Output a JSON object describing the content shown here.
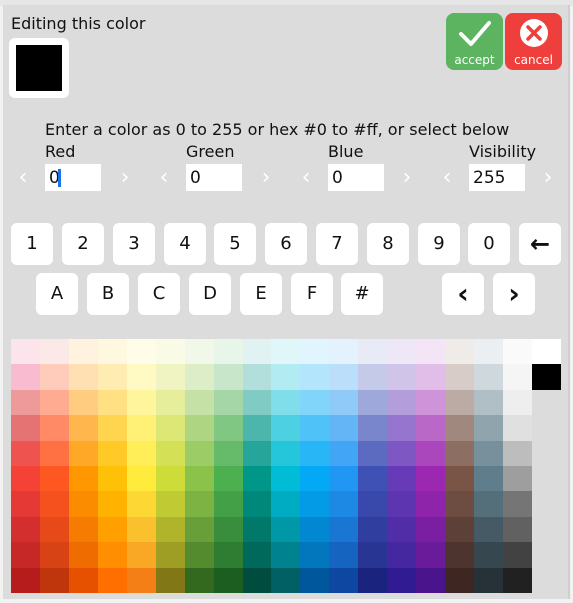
{
  "ruler": [
    "21",
    "28",
    "35",
    "42",
    "49",
    "56",
    "63",
    "70",
    "77",
    "84",
    "91"
  ],
  "title": "Editing this color",
  "current_color": "#000000",
  "accept": {
    "label": "accept",
    "color": "#5cb460",
    "icon": "check-icon"
  },
  "cancel": {
    "label": "cancel",
    "color": "#ef3f3d",
    "icon": "close-icon"
  },
  "instructions": "Enter a color as 0 to 255 or hex #0 to #ff, or select below",
  "channels": [
    {
      "label": "Red",
      "value": "0"
    },
    {
      "label": "Green",
      "value": "0"
    },
    {
      "label": "Blue",
      "value": "0"
    },
    {
      "label": "Visibility",
      "value": "255"
    }
  ],
  "chevrons": {
    "left": "‹",
    "right": "›"
  },
  "digit_keys": [
    "1",
    "2",
    "3",
    "4",
    "5",
    "6",
    "7",
    "8",
    "9",
    "0"
  ],
  "backspace_key": "←",
  "hex_keys": [
    "A",
    "B",
    "C",
    "D",
    "E",
    "F",
    "#"
  ],
  "nav_keys": [
    "‹",
    "›"
  ],
  "palette_rows": [
    [
      "#fce4ec",
      "#fbe9e7",
      "#fff3e0",
      "#fff8e1",
      "#fffde7",
      "#f9fbe7",
      "#f1f8e9",
      "#e8f5e9",
      "#e0f2f1",
      "#e0f7fa",
      "#e1f5fe",
      "#e3f2fd",
      "#e8eaf6",
      "#ede7f6",
      "#f3e5f5",
      "#efebe9",
      "#eceff1",
      "#fafafa"
    ],
    [
      "#f8bbd0",
      "#ffccbc",
      "#ffe0b2",
      "#ffecb3",
      "#fff9c4",
      "#f0f4c3",
      "#dcedc8",
      "#c8e6c9",
      "#b2dfdb",
      "#b2ebf2",
      "#b3e5fc",
      "#bbdefb",
      "#c5cae9",
      "#d1c4e9",
      "#e1bee7",
      "#d7ccc8",
      "#cfd8dc",
      "#f5f5f5"
    ],
    [
      "#ef9a9a",
      "#ffab91",
      "#ffcc80",
      "#ffe082",
      "#fff59d",
      "#e6ee9c",
      "#c5e1a5",
      "#a5d6a7",
      "#80cbc4",
      "#80deea",
      "#81d4fa",
      "#90caf9",
      "#9fa8da",
      "#b39ddb",
      "#ce93d8",
      "#bcaaa4",
      "#b0bec5",
      "#eeeeee"
    ],
    [
      "#e57373",
      "#ff8a65",
      "#ffb74d",
      "#ffd54f",
      "#fff176",
      "#dce775",
      "#aed581",
      "#81c784",
      "#4db6ac",
      "#4dd0e1",
      "#4fc3f7",
      "#64b5f6",
      "#7986cb",
      "#9575cd",
      "#ba68c8",
      "#a1887f",
      "#90a4ae",
      "#e0e0e0"
    ],
    [
      "#ef5350",
      "#ff7043",
      "#ffa726",
      "#ffca28",
      "#ffee58",
      "#d4e157",
      "#9ccc65",
      "#66bb6a",
      "#26a69a",
      "#26c6da",
      "#29b6f6",
      "#42a5f5",
      "#5c6bc0",
      "#7e57c2",
      "#ab47bc",
      "#8d6e63",
      "#78909c",
      "#bdbdbd"
    ],
    [
      "#f44336",
      "#ff5722",
      "#ff9800",
      "#ffc107",
      "#ffeb3b",
      "#cddc39",
      "#8bc34a",
      "#4caf50",
      "#009688",
      "#00bcd4",
      "#03a9f4",
      "#2196f3",
      "#3f51b5",
      "#673ab7",
      "#9c27b0",
      "#795548",
      "#607d8b",
      "#9e9e9e"
    ],
    [
      "#e53935",
      "#f4511e",
      "#fb8c00",
      "#ffb300",
      "#fdd835",
      "#c0ca33",
      "#7cb342",
      "#43a047",
      "#00897b",
      "#00acc1",
      "#039be5",
      "#1e88e5",
      "#3949ab",
      "#5e35b1",
      "#8e24aa",
      "#6d4c41",
      "#546e7a",
      "#757575"
    ],
    [
      "#d32f2f",
      "#e64a19",
      "#f57c00",
      "#ffa000",
      "#fbc02d",
      "#afb42b",
      "#689f38",
      "#388e3c",
      "#00796b",
      "#0097a7",
      "#0288d1",
      "#1976d2",
      "#303f9f",
      "#512da8",
      "#7b1fa2",
      "#5d4037",
      "#455a64",
      "#616161"
    ],
    [
      "#c62828",
      "#d84315",
      "#ef6c00",
      "#ff8f00",
      "#f9a825",
      "#9e9d24",
      "#558b2f",
      "#2e7d32",
      "#00695c",
      "#00838f",
      "#0277bd",
      "#1565c0",
      "#283593",
      "#4527a0",
      "#6a1b9a",
      "#4e342e",
      "#37474f",
      "#424242"
    ],
    [
      "#b71c1c",
      "#bf360c",
      "#e65100",
      "#ff6f00",
      "#f57f17",
      "#827717",
      "#33691e",
      "#1b5e20",
      "#004d40",
      "#006064",
      "#01579b",
      "#0d47a1",
      "#1a237e",
      "#311b92",
      "#4a148c",
      "#3e2723",
      "#263238",
      "#212121"
    ]
  ],
  "selected_column": [
    "#ffffff",
    "#000000",
    "#dcdcdc",
    "#dcdcdc",
    "#dcdcdc",
    "#dcdcdc",
    "#dcdcdc",
    "#dcdcdc",
    "#dcdcdc",
    "#dcdcdc"
  ]
}
